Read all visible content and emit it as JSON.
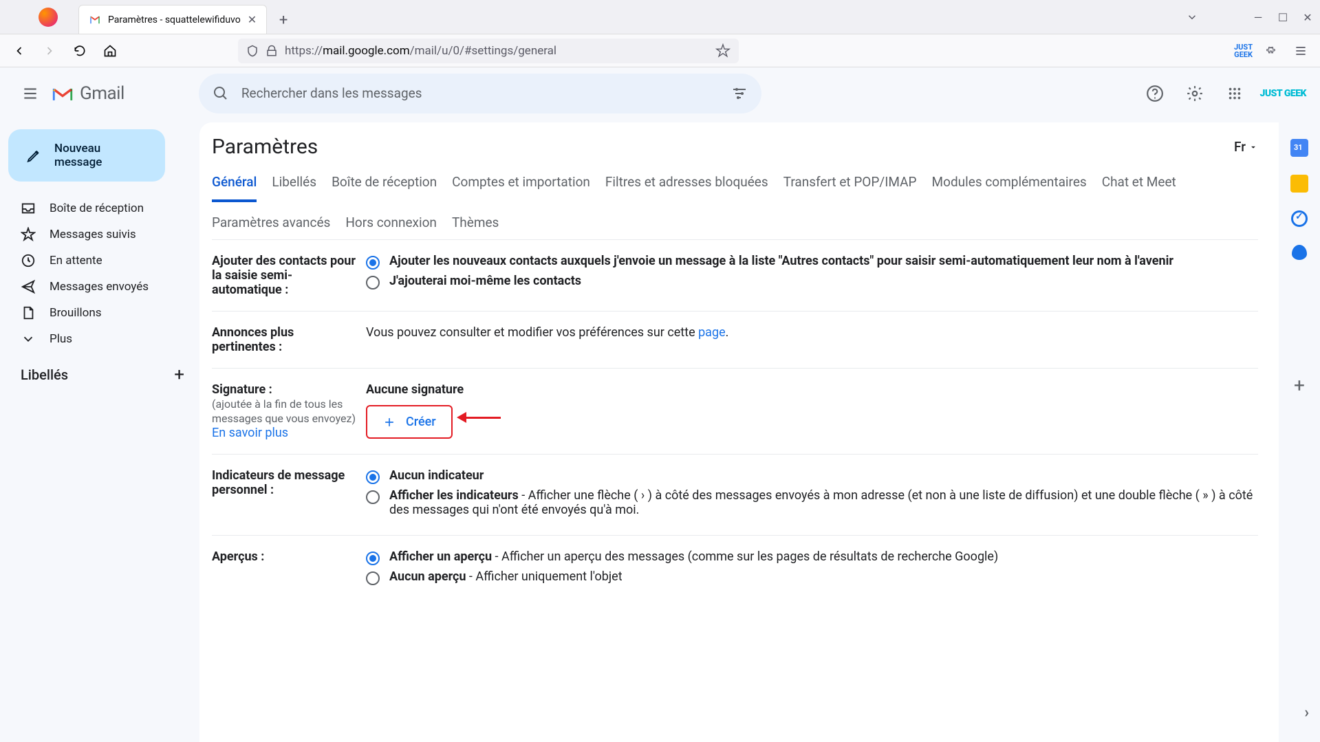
{
  "browser": {
    "tab_title": "Paramètres - squattelewifiduvo",
    "url_proto": "https://",
    "url_host": "mail.google.com",
    "url_path": "/mail/u/0/#settings/general"
  },
  "header": {
    "app_name": "Gmail",
    "search_placeholder": "Rechercher dans les messages",
    "brand": "JUST GEEK"
  },
  "compose_label": "Nouveau message",
  "nav_items": [
    {
      "icon": "inbox",
      "label": "Boîte de réception"
    },
    {
      "icon": "star",
      "label": "Messages suivis"
    },
    {
      "icon": "clock",
      "label": "En attente"
    },
    {
      "icon": "send",
      "label": "Messages envoyés"
    },
    {
      "icon": "file",
      "label": "Brouillons"
    },
    {
      "icon": "chevron-down",
      "label": "Plus"
    }
  ],
  "labels_title": "Libellés",
  "settings": {
    "title": "Paramètres",
    "lang": "Fr",
    "tabs": [
      "Général",
      "Libellés",
      "Boîte de réception",
      "Comptes et importation",
      "Filtres et adresses bloquées",
      "Transfert et POP/IMAP",
      "Modules complémentaires",
      "Chat et Meet",
      "Paramètres avancés",
      "Hors connexion",
      "Thèmes"
    ],
    "active_tab": 0,
    "contacts_label": "Ajouter des contacts pour la saisie semi-automatique :",
    "contacts_opt1": "Ajouter les nouveaux contacts auxquels j'envoie un message à la liste \"Autres contacts\" pour saisir semi-automatiquement leur nom à l'avenir",
    "contacts_opt2": "J'ajouterai moi-même les contacts",
    "ads_label": "Annonces plus pertinentes :",
    "ads_text": "Vous pouvez consulter et modifier vos préférences sur cette ",
    "ads_link": "page",
    "ads_period": ".",
    "signature_label": "Signature :",
    "signature_sub": "(ajoutée à la fin de tous les messages que vous envoyez)",
    "signature_learn": "En savoir plus",
    "signature_none": "Aucune signature",
    "signature_create": "Créer",
    "indicators_label": "Indicateurs de message personnel :",
    "indicators_opt1": "Aucun indicateur",
    "indicators_opt2_bold": "Afficher les indicateurs",
    "indicators_opt2_desc": " - Afficher une flèche ( › ) à côté des messages envoyés à mon adresse (et non à une liste de diffusion) et une double flèche ( » ) à côté des messages qui n'ont été envoyés qu'à moi.",
    "snippets_label": "Aperçus :",
    "snippets_opt1_bold": "Afficher un aperçu",
    "snippets_opt1_desc": " - Afficher un aperçu des messages (comme sur les pages de résultats de recherche Google)",
    "snippets_opt2_bold": "Aucun aperçu",
    "snippets_opt2_desc": " - Afficher uniquement l'objet"
  }
}
